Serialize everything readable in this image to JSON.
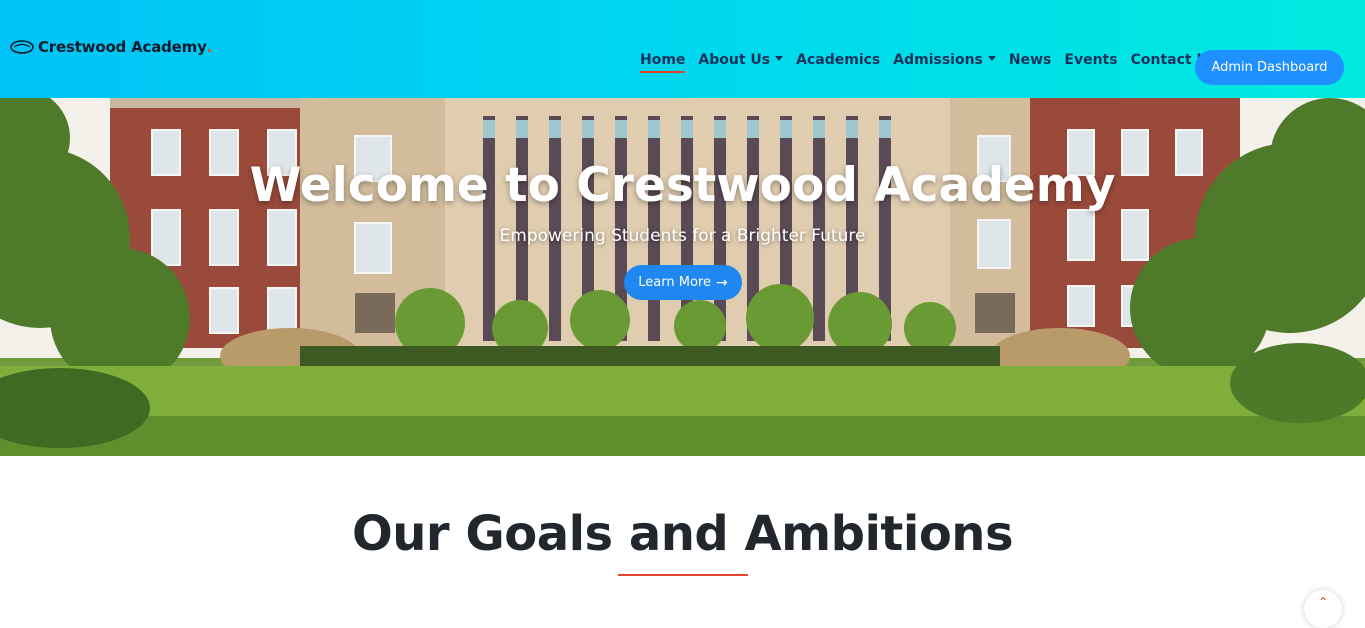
{
  "brand": {
    "name": "Crestwood Academy",
    "dot": ".",
    "logo_icon": "ring-logo-icon"
  },
  "nav": {
    "items": [
      {
        "label": "Home",
        "active": true,
        "dropdown": false
      },
      {
        "label": "About Us",
        "active": false,
        "dropdown": true
      },
      {
        "label": "Academics",
        "active": false,
        "dropdown": false
      },
      {
        "label": "Admissions",
        "active": false,
        "dropdown": true
      },
      {
        "label": "News",
        "active": false,
        "dropdown": false
      },
      {
        "label": "Events",
        "active": false,
        "dropdown": false
      },
      {
        "label": "Contact Us",
        "active": false,
        "dropdown": false
      }
    ],
    "admin_button": "Admin Dashboard"
  },
  "hero": {
    "title": "Welcome to Crestwood Academy",
    "subtitle": "Empowering Students for a Brighter Future",
    "cta_label": "Learn More",
    "cta_icon": "arrow-right-icon"
  },
  "goals": {
    "title": "Our Goals and Ambitions"
  },
  "scroll_top": {
    "icon": "chevron-up-icon"
  },
  "colors": {
    "accent": "#e2452b",
    "primary_button": "#1e90ff",
    "nav_gradient_start": "#00c3f7",
    "nav_gradient_end": "#00eadf"
  }
}
